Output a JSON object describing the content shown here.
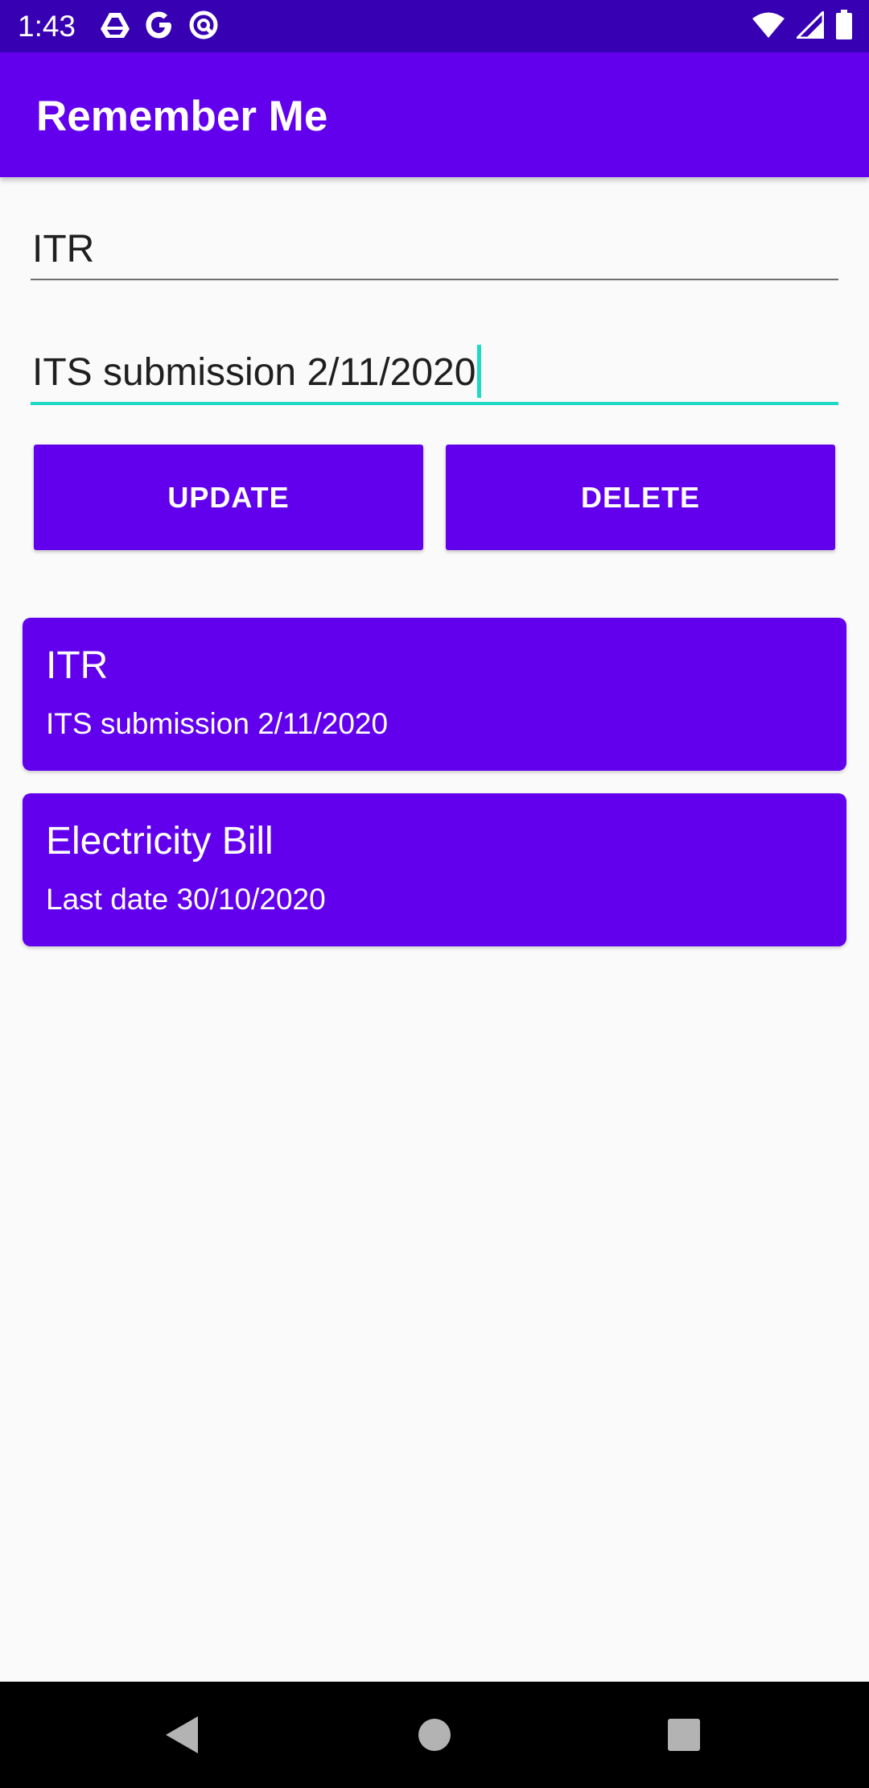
{
  "status_bar": {
    "time": "1:43",
    "left_icons": [
      "drive-icon",
      "google-icon",
      "sync-icon"
    ],
    "right_icons": [
      "wifi-icon",
      "cellular-signal-icon",
      "battery-icon"
    ]
  },
  "app_bar": {
    "title": "Remember Me"
  },
  "form": {
    "title_value": "ITR",
    "description_value": "ITS submission 2/11/2020"
  },
  "buttons": {
    "update_label": "UPDATE",
    "delete_label": "DELETE"
  },
  "notes": [
    {
      "title": "ITR",
      "description": "ITS submission 2/11/2020"
    },
    {
      "title": "Electricity Bill",
      "description": "Last date 30/10/2020"
    }
  ],
  "nav_bar": {
    "icons": [
      "back-icon",
      "home-icon",
      "recents-icon"
    ]
  },
  "colors": {
    "status_bar": "#3700B3",
    "primary": "#6200EE",
    "accent": "#1ED9C5",
    "background": "#FAFAFA"
  }
}
